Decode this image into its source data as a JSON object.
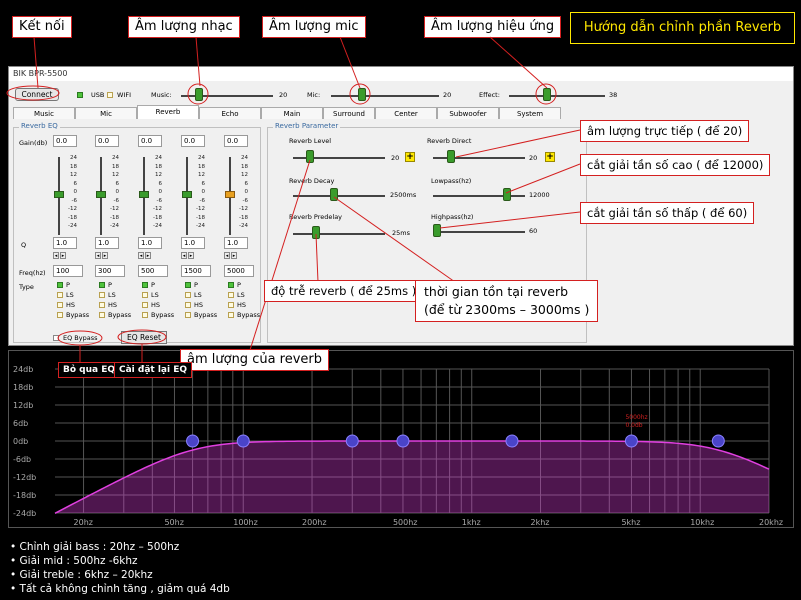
{
  "window_title": "BIK BPR-5500",
  "guide_title": "Hướng dẫn chỉnh phần Reverb",
  "callouts": {
    "connect": "Kết nối",
    "music": "Âm lượng nhạc",
    "mic": "Âm lượng mic",
    "effect": "Âm lượng hiệu ứng",
    "direct": "âm lượng trực tiếp ( để 20)",
    "lowpass": "cắt giải tần số cao ( để 12000)",
    "highpass": "cắt giải tần số thấp ( để 60)",
    "predelay": "độ trễ reverb ( để 25ms )",
    "decay_l1": "thời gian tồn tại reverb",
    "decay_l2": "(để từ 2300ms – 3000ms )",
    "level": "âm lượng của reverb",
    "eq_bypass": "Bỏ qua EQ",
    "eq_reset": "Cài đặt lại EQ"
  },
  "toolbar": {
    "connect": "Connect",
    "usb": "USB",
    "wifi": "WIFI",
    "music_label": "Music:",
    "music_value": "20",
    "mic_label": "Mic:",
    "mic_value": "20",
    "effect_label": "Effect:",
    "effect_value": "38"
  },
  "tabs": [
    "Music",
    "Mic",
    "Reverb",
    "Echo",
    "Main",
    "Surround",
    "Center",
    "Subwoofer",
    "System"
  ],
  "reverb_eq": {
    "group_label": "Reverb EQ",
    "gain_label": "Gain(db)",
    "q_label": "Q",
    "freq_label": "Freq(hz)",
    "type_label": "Type",
    "gain_ticks": [
      "24",
      "18",
      "12",
      "6",
      "0",
      "-6",
      "-12",
      "-18",
      "-24"
    ],
    "bands": [
      {
        "gain": "0.0",
        "q": "1.0",
        "freq": "100"
      },
      {
        "gain": "0.0",
        "q": "1.0",
        "freq": "300"
      },
      {
        "gain": "0.0",
        "q": "1.0",
        "freq": "500"
      },
      {
        "gain": "0.0",
        "q": "1.0",
        "freq": "1500"
      },
      {
        "gain": "0.0",
        "q": "1.0",
        "freq": "5000"
      }
    ],
    "types": [
      "P",
      "LS",
      "HS",
      "Bypass"
    ],
    "eq_bypass": "EQ Bypass",
    "eq_reset": "EQ Reset"
  },
  "reverb_param": {
    "group_label": "Reverb Parameter",
    "level_label": "Reverb Level",
    "level_value": "20",
    "direct_label": "Reverb Direct",
    "direct_value": "20",
    "decay_label": "Reverb Decay",
    "decay_value": "2500ms",
    "lowpass_label": "Lowpass(hz)",
    "lowpass_value": "12000",
    "predelay_label": "Reverb Predelay",
    "predelay_value": "25ms",
    "highpass_label": "Highpass(hz)",
    "highpass_value": "60",
    "plus": "+"
  },
  "eq_graph": {
    "y_ticks": [
      "24db",
      "18db",
      "12db",
      "6db",
      "0db",
      "-6db",
      "-12db",
      "-18db",
      "-24db"
    ],
    "x_ticks": [
      "20hz",
      "50hz",
      "100hz",
      "200hz",
      "500hz",
      "1khz",
      "2khz",
      "5khz",
      "10khz",
      "20khz"
    ],
    "x_tick_freqs": [
      20,
      50,
      100,
      200,
      500,
      1000,
      2000,
      5000,
      10000,
      20000
    ],
    "nodes_hz": [
      60,
      100,
      300,
      500,
      1500,
      5000,
      12000
    ],
    "node_label_1": "5000hz",
    "node_label_2": "0.0db",
    "curve_color": "#e040e0"
  },
  "notes": [
    "• Chỉnh giải bass : 20hz – 500hz",
    "• Giải mid : 500hz -6khz",
    "• Giải treble : 6khz – 20khz",
    "• Tất cả không chỉnh tăng , giảm quá 4db"
  ]
}
